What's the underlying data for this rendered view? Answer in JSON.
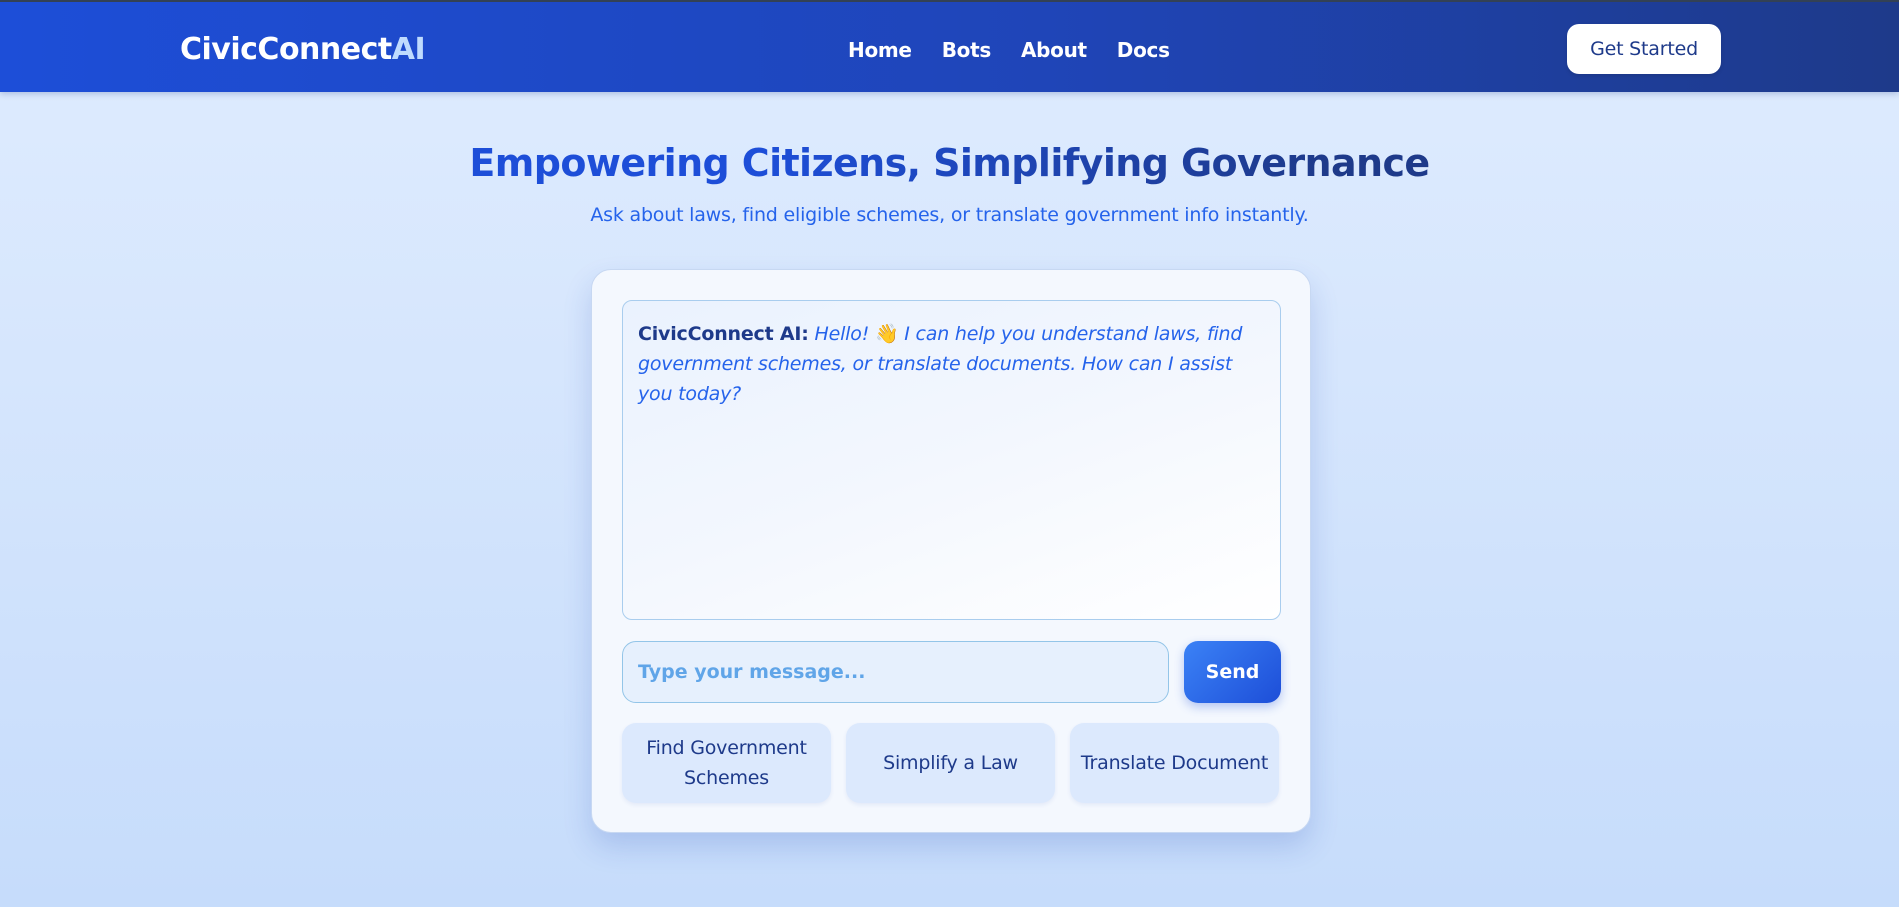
{
  "header": {
    "logo_main": "CivicConnect",
    "logo_accent": "AI",
    "nav": [
      {
        "label": "Home"
      },
      {
        "label": "Bots"
      },
      {
        "label": "About"
      },
      {
        "label": "Docs"
      }
    ],
    "cta_label": "Get Started"
  },
  "hero": {
    "title": "Empowering Citizens, Simplifying Governance",
    "subtitle": "Ask about laws, find eligible schemes, or translate government info instantly."
  },
  "chat": {
    "messages": [
      {
        "sender": "CivicConnect AI:",
        "greeting": "Hello!",
        "emoji": "👋",
        "text": "I can help you understand laws, find government schemes, or translate documents. How can I assist you today?"
      }
    ],
    "input": {
      "placeholder": "Type your message...",
      "value": ""
    },
    "send_label": "Send",
    "quick_actions": [
      {
        "label": "Find Government Schemes"
      },
      {
        "label": "Simplify a Law"
      },
      {
        "label": "Translate Document"
      }
    ]
  },
  "colors": {
    "header_start": "#1d4ed8",
    "header_end": "#1e3a8a",
    "accent": "#2563eb",
    "page_bg": "#dbeafe"
  }
}
